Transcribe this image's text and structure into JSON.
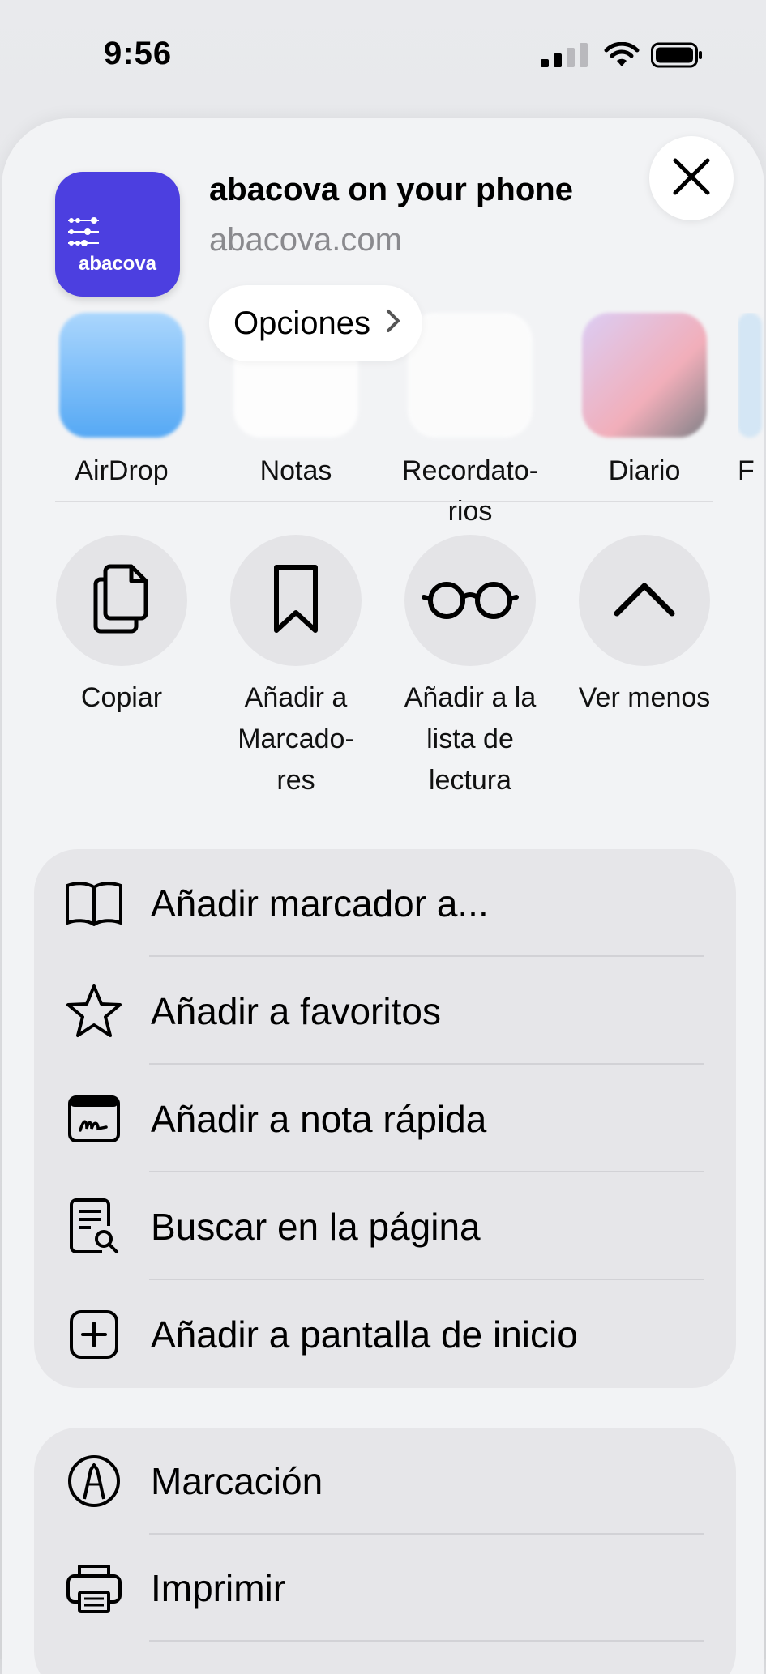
{
  "status_bar": {
    "time": "9:56"
  },
  "header": {
    "logo_text": "abacova",
    "title": "abacova on your phone",
    "url": "abacova.com",
    "options_label": "Opciones"
  },
  "apps": [
    {
      "label": "AirDrop",
      "icon": "airdrop-icon"
    },
    {
      "label": "Notas",
      "icon": "notes-icon"
    },
    {
      "label": "Recordato-\nrios",
      "icon": "reminders-icon"
    },
    {
      "label": "Diario",
      "icon": "journal-icon"
    },
    {
      "label": "F",
      "icon": "app-icon"
    }
  ],
  "actions": [
    {
      "label": "Copiar",
      "icon": "copy-icon"
    },
    {
      "label": "Añadir a\nMarcado-\nres",
      "icon": "bookmark-icon"
    },
    {
      "label": "Añadir a la\nlista de\nlectura",
      "icon": "glasses-icon"
    },
    {
      "label": "Ver menos",
      "icon": "chevron-up-icon"
    }
  ],
  "list_group_1": [
    {
      "label": "Añadir marcador a...",
      "icon": "book-icon"
    },
    {
      "label": "Añadir a favoritos",
      "icon": "star-icon"
    },
    {
      "label": "Añadir a nota rápida",
      "icon": "quick-note-icon"
    },
    {
      "label": "Buscar en la página",
      "icon": "find-in-page-icon"
    },
    {
      "label": "Añadir a pantalla de inicio",
      "icon": "add-square-icon"
    }
  ],
  "list_group_2": [
    {
      "label": "Marcación",
      "icon": "markup-icon"
    },
    {
      "label": "Imprimir",
      "icon": "printer-icon"
    }
  ]
}
